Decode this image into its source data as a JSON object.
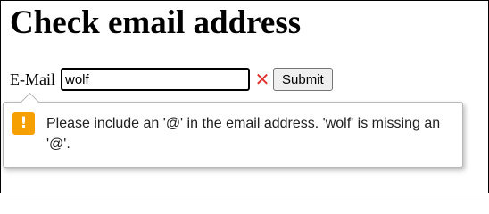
{
  "page": {
    "title": "Check email address"
  },
  "form": {
    "email_label": "E-Mail",
    "email_value": "wolf",
    "invalid_icon": "close-icon",
    "invalid_color": "#e03030",
    "submit_label": "Submit"
  },
  "validation_tooltip": {
    "icon": "warning-icon",
    "icon_color": "#f5a000",
    "message": "Please include an '@' in the email address. 'wolf' is missing an '@'."
  }
}
